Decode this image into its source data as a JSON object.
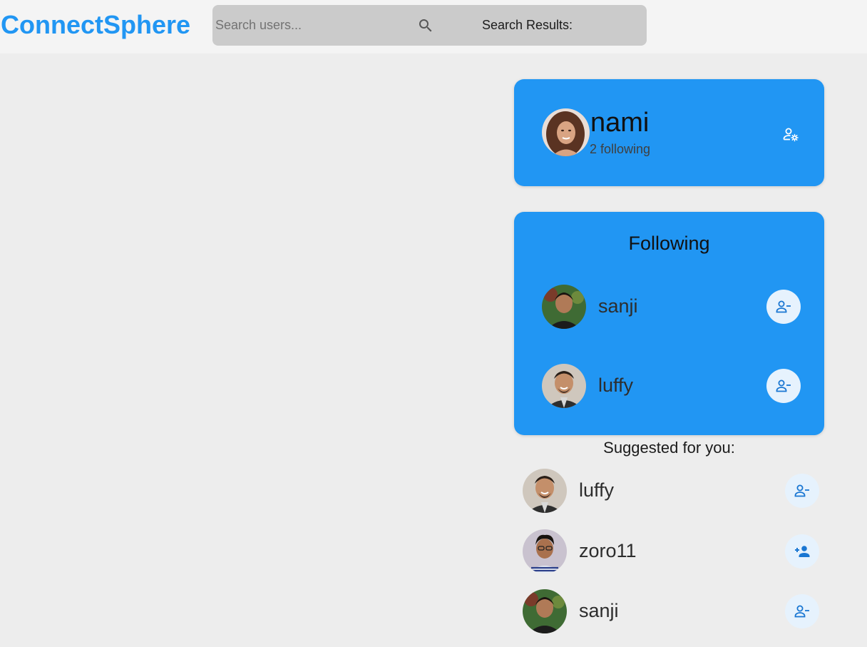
{
  "header": {
    "brand": "ConnectSphere",
    "search_placeholder": "Search users...",
    "search_icon": "search-icon",
    "search_results_label": "Search Results:"
  },
  "profile": {
    "username": "nami",
    "following_text": "2 following",
    "settings_icon": "manage-account-icon"
  },
  "following": {
    "title": "Following",
    "users": [
      {
        "name": "sanji",
        "action_icon": "person-remove-icon"
      },
      {
        "name": "luffy",
        "action_icon": "person-remove-icon"
      }
    ]
  },
  "suggested": {
    "title": "Suggested for you:",
    "users": [
      {
        "name": "luffy",
        "action_icon": "person-remove-icon"
      },
      {
        "name": "zoro11",
        "action_icon": "person-add-icon"
      },
      {
        "name": "sanji",
        "action_icon": "person-remove-icon"
      }
    ]
  },
  "colors": {
    "brand": "#2196f3",
    "card": "#2196f3",
    "page_bg": "#ededed",
    "header_bg": "#f4f4f4",
    "search_bg": "#cbcbcb",
    "action_btn_bg": "#e6f2fd",
    "action_icon": "#1976d2"
  }
}
